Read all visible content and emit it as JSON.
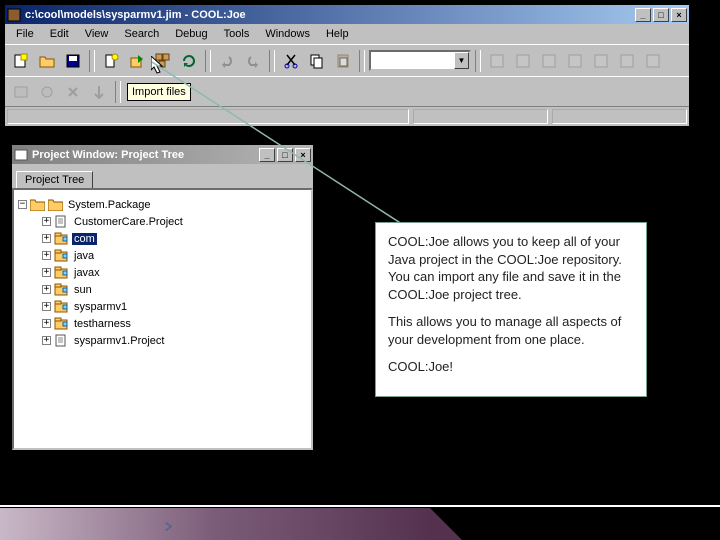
{
  "mainWindow": {
    "title": "c:\\cool\\models\\sysparmv1.jim - COOL:Joe",
    "menus": [
      "File",
      "Edit",
      "View",
      "Search",
      "Debug",
      "Tools",
      "Windows",
      "Help"
    ],
    "tooltip": "Import files",
    "combo_value": ""
  },
  "projectWindow": {
    "title": "Project Window: Project Tree",
    "tab": "Project Tree"
  },
  "tree": {
    "root": "System.Package",
    "items": [
      {
        "label": "CustomerCare.Project",
        "icon": "doc",
        "exp": "+"
      },
      {
        "label": "com",
        "icon": "pkg",
        "exp": "+",
        "selected": true
      },
      {
        "label": "java",
        "icon": "pkg",
        "exp": "+"
      },
      {
        "label": "javax",
        "icon": "pkg",
        "exp": "+"
      },
      {
        "label": "sun",
        "icon": "pkg",
        "exp": "+"
      },
      {
        "label": "sysparmv1",
        "icon": "pkg",
        "exp": "+"
      },
      {
        "label": "testharness",
        "icon": "pkg",
        "exp": "+"
      },
      {
        "label": "sysparmv1.Project",
        "icon": "doc",
        "exp": "+"
      }
    ]
  },
  "callout": {
    "p1": "COOL:Joe allows you to keep all of your Java project in the COOL:Joe repository.  You can import any file and save it in the COOL:Joe project tree.",
    "p2": "This allows you to manage all aspects of your development from one place.",
    "p3": "COOL:Joe!"
  }
}
